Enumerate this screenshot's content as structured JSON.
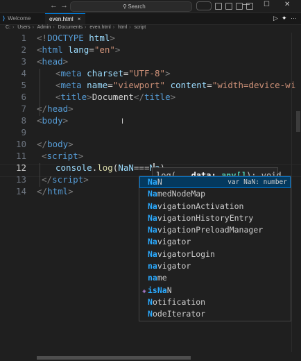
{
  "titlebar": {
    "back": "←",
    "forward": "→",
    "search_label": "Search",
    "search_glyph": "⚲",
    "minimize": "—",
    "maximize": "☐",
    "close": "✕"
  },
  "tabs": [
    {
      "label": "Welcome",
      "logo": "⟩"
    },
    {
      "label": "even.html",
      "close": "×"
    }
  ],
  "run": {
    "play": "▷",
    "sparkle": "✦",
    "more": "···"
  },
  "breadcrumb": [
    "C:",
    "Users",
    "Admin",
    "Documents",
    "even.html",
    "html",
    "script"
  ],
  "gutter": [
    "1",
    "2",
    "3",
    "4",
    "5",
    "6",
    "7",
    "8",
    "9",
    "10",
    "11",
    "12",
    "13",
    "14"
  ],
  "code": {
    "l1": {
      "a": "<!",
      "b": "DOCTYPE",
      "c": " html",
      "d": ">"
    },
    "l2": {
      "a": "<",
      "b": "html",
      "c": " lang",
      "d": "=",
      "e": "\"en\"",
      "f": ">"
    },
    "l3": {
      "a": "<",
      "b": "head",
      "c": ">"
    },
    "l4": {
      "a": "<",
      "b": "meta",
      "c": " charset",
      "d": "=",
      "e": "\"UTF-8\"",
      "f": ">"
    },
    "l5": {
      "a": "<",
      "b": "meta",
      "c": " name",
      "d": "=",
      "e": "\"viewport\"",
      "f": " content",
      "g": "=",
      "h": "\"width=device-wi"
    },
    "l6": {
      "a": "<",
      "b": "title",
      "c": ">",
      "d": "Document",
      "e": "</",
      "f": "title",
      "g": ">"
    },
    "l7": {
      "a": "</",
      "b": "head",
      "c": ">"
    },
    "l8": {
      "a": "<",
      "b": "body",
      "c": ">"
    },
    "l10": {
      "a": "</",
      "b": "body",
      "c": ">"
    },
    "l11": {
      "a": "<",
      "b": "script",
      "c": ">"
    },
    "l12": {
      "a": "console",
      "b": ".",
      "c": "log",
      "d": "(",
      "e": "NaN",
      "f": "===",
      "g": "Na",
      "h": ")"
    },
    "l13": {
      "a": "</",
      "b": "script",
      "c": ">"
    },
    "l14": {
      "a": "</",
      "b": "html",
      "c": ">"
    }
  },
  "signature_hint": {
    "fn": "log(",
    "params": "...data",
    "sep": ": ",
    "type": "any[]",
    "rest": "): void"
  },
  "suggestions": [
    {
      "match": "Na",
      "rest": "N",
      "detail": "var NaN: number",
      "kind": ""
    },
    {
      "match": "Na",
      "rest": "medNodeMap",
      "kind": ""
    },
    {
      "match": "Na",
      "rest": "vigationActivation",
      "kind": ""
    },
    {
      "match": "Na",
      "rest": "vigationHistoryEntry",
      "kind": ""
    },
    {
      "match": "Na",
      "rest": "vigationPreloadManager",
      "kind": ""
    },
    {
      "match": "Na",
      "rest": "vigator",
      "kind": ""
    },
    {
      "match": "Na",
      "rest": "vigatorLogin",
      "kind": ""
    },
    {
      "match": "na",
      "rest": "vigator",
      "kind": ""
    },
    {
      "match": "na",
      "rest": "me",
      "kind": ""
    },
    {
      "match": "isNa",
      "rest": "N",
      "kind": "◈"
    },
    {
      "match": "N",
      "rest": "otification",
      "kind": ""
    },
    {
      "match": "N",
      "rest": "odeIterator",
      "kind": ""
    }
  ]
}
